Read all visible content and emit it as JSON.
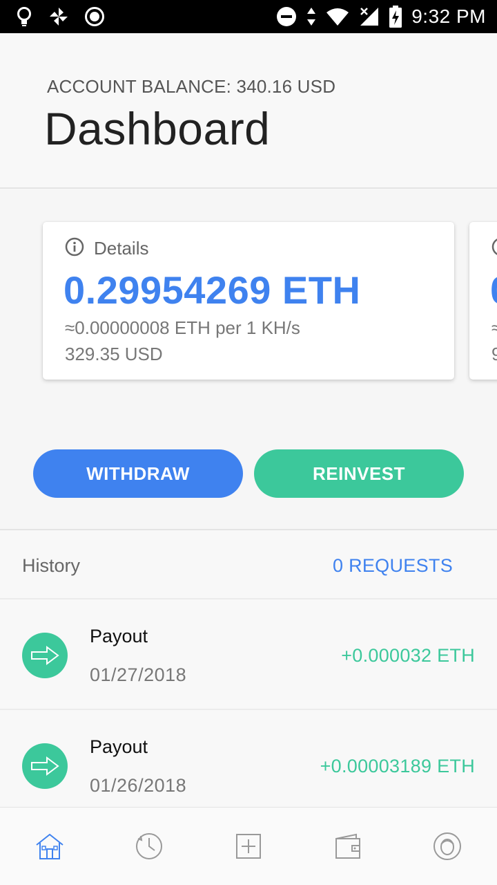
{
  "status_bar": {
    "time": "9:32 PM",
    "left_icons": [
      "lightbulb-icon",
      "pinwheel-icon",
      "record-icon"
    ],
    "right_icons": [
      "do-not-disturb-icon",
      "data-arrows-icon",
      "wifi-icon",
      "signal-icon",
      "battery-charging-icon"
    ]
  },
  "header": {
    "balance_label": "ACCOUNT BALANCE: 340.16 USD",
    "title": "Dashboard"
  },
  "card": {
    "label": "Details",
    "amount": "0.29954269 ETH",
    "rate": "≈0.00000008 ETH per 1 KH/s",
    "usd": "329.35 USD",
    "next_card_peek": {
      "amount_partial": "0",
      "rate_partial": "≈",
      "usd_partial": "9"
    }
  },
  "actions": {
    "withdraw_label": "WITHDRAW",
    "reinvest_label": "REINVEST"
  },
  "history": {
    "title": "History",
    "requests_label": "0 REQUESTS",
    "items": [
      {
        "type": "Payout",
        "date": "01/27/2018",
        "amount": "+0.000032 ETH"
      },
      {
        "type": "Payout",
        "date": "01/26/2018",
        "amount": "+0.00003189 ETH"
      }
    ]
  },
  "bottom_nav": {
    "items": [
      "home-icon",
      "history-clock-icon",
      "add-icon",
      "wallet-icon",
      "profile-icon"
    ],
    "active": "home-icon"
  },
  "colors": {
    "accent_blue": "#3f82ef",
    "accent_green": "#3cc89b",
    "status_bar": "#000000"
  }
}
